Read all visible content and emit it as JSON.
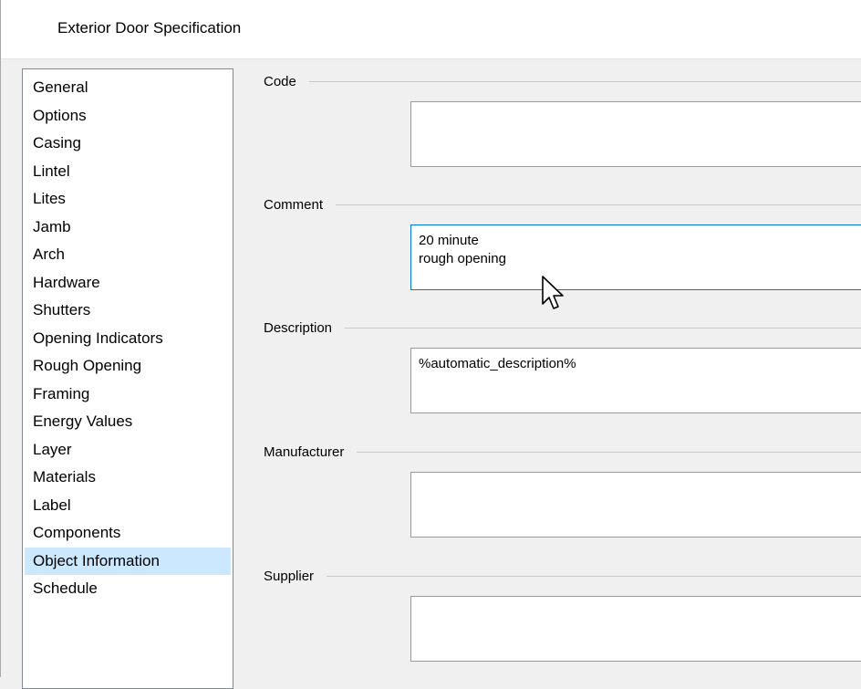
{
  "window": {
    "title": "Exterior Door Specification"
  },
  "categories": [
    {
      "label": "General",
      "selected": false
    },
    {
      "label": "Options",
      "selected": false
    },
    {
      "label": "Casing",
      "selected": false
    },
    {
      "label": "Lintel",
      "selected": false
    },
    {
      "label": "Lites",
      "selected": false
    },
    {
      "label": "Jamb",
      "selected": false
    },
    {
      "label": "Arch",
      "selected": false
    },
    {
      "label": "Hardware",
      "selected": false
    },
    {
      "label": "Shutters",
      "selected": false
    },
    {
      "label": "Opening Indicators",
      "selected": false
    },
    {
      "label": "Rough Opening",
      "selected": false
    },
    {
      "label": "Framing",
      "selected": false
    },
    {
      "label": "Energy Values",
      "selected": false
    },
    {
      "label": "Layer",
      "selected": false
    },
    {
      "label": "Materials",
      "selected": false
    },
    {
      "label": "Label",
      "selected": false
    },
    {
      "label": "Components",
      "selected": false
    },
    {
      "label": "Object Information",
      "selected": true
    },
    {
      "label": "Schedule",
      "selected": false
    }
  ],
  "fields": {
    "code": {
      "label": "Code",
      "value": ""
    },
    "comment": {
      "label": "Comment",
      "value": "20 minute\nrough opening"
    },
    "description": {
      "label": "Description",
      "value": "%automatic_description%"
    },
    "manufacturer": {
      "label": "Manufacturer",
      "value": ""
    },
    "supplier": {
      "label": "Supplier",
      "value": ""
    }
  },
  "colors": {
    "selection": "#cce8ff",
    "focus_border": "#0078d7",
    "panel_background": "#f0f0f0"
  },
  "icons": {
    "mouse_cursor": "arrow-pointer"
  }
}
